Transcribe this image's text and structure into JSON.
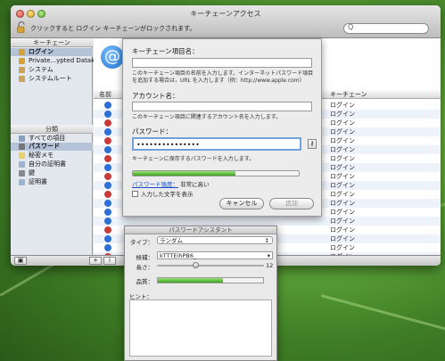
{
  "window": {
    "title": "キーチェーンアクセス",
    "lock_text": "クリックすると ログイン キーチェーンがロックされます。",
    "search_placeholder": "Q"
  },
  "sidebar": {
    "keychains_header": "キーチェーン",
    "keychains": [
      {
        "label": "ログイン",
        "selected": true
      },
      {
        "label": "Private...ypted Datak"
      },
      {
        "label": "システム"
      },
      {
        "label": "システムルート"
      }
    ],
    "category_header": "分類",
    "categories": [
      {
        "label": "すべての項目"
      },
      {
        "label": "パスワード",
        "selected": true
      },
      {
        "label": "秘密メモ"
      },
      {
        "label": "自分の証明書"
      },
      {
        "label": "鍵"
      },
      {
        "label": "証明書"
      }
    ]
  },
  "list": {
    "col_name": "名前",
    "col_keychain": "キーチェーン",
    "rows": [
      "ログイン",
      "ログイン",
      "ログイン",
      "ログイン",
      "ログイン",
      "ログイン",
      "ログイン",
      "ログイン",
      "ログイン",
      "ログイン",
      "ログイン",
      "ログイン",
      "ログイン",
      "ログイン",
      "ログイン",
      "ログイン",
      "ログイン",
      "ログイン",
      "ログイン",
      "ログイン",
      "ログイン"
    ]
  },
  "bottom_bar": {
    "plus": "+",
    "info": "i"
  },
  "sheet": {
    "item_name_label": "キーチェーン項目名：",
    "item_name_desc": "このキーチェーン項目の名前を入力します。インターネットパスワード項目を追加する場合は，URL を入力します（例：http://www.apple.com）",
    "account_label": "アカウント名：",
    "account_desc": "このキーチェーン項目に関連するアカウント名を入力します。",
    "password_label": "パスワード：",
    "password_value": "•••••••••••••••",
    "password_desc": "キーチェーンに保存するパスワードを入力します。",
    "strength_fraction": 0.62,
    "quality_link": "パスワード強度：",
    "quality_value": "非常に高い",
    "show_chars_label": "入力した文字を表示",
    "cancel_label": "キャンセル",
    "add_label": "追加",
    "key_icon": "key-icon"
  },
  "assistant": {
    "title": "パスワードアシスタント",
    "type_label": "タイプ：",
    "type_value": "ランダム",
    "suggestion_label": "候補：",
    "suggestion_value": "kTTTEihPB6_",
    "length_label": "長さ：",
    "length_value": "12",
    "length_fraction": 0.35,
    "quality_label": "品質：",
    "quality_fraction": 0.62,
    "hint_label": "ヒント："
  },
  "colors": {
    "accent": "#3aa51d",
    "selection": "#b5c3d8",
    "link": "#1a4fc9"
  }
}
